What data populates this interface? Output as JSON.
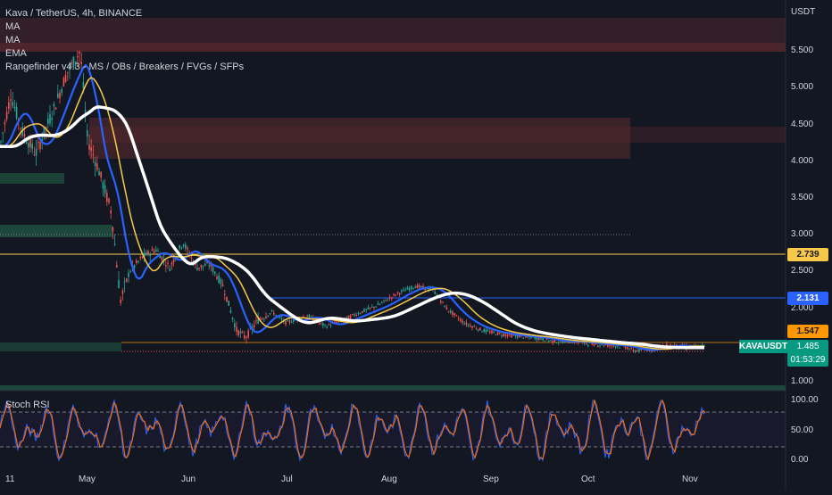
{
  "header": {
    "title": "Kava / TetherUS, 4h, BINANCE",
    "quote_currency": "USDT"
  },
  "indicators": [
    "MA",
    "MA",
    "EMA",
    "Rangefinder v4.3 - MS / OBs / Breakers / FVGs / SFPs"
  ],
  "price_axis": [
    "5.500",
    "5.000",
    "4.500",
    "4.000",
    "3.500",
    "3.000",
    "2.500",
    "2.000",
    "1.000"
  ],
  "time_axis": [
    "11",
    "May",
    "Jun",
    "Jul",
    "Aug",
    "Sep",
    "Oct",
    "Nov"
  ],
  "price_tags": {
    "level_a": "2.739",
    "level_b": "2.131",
    "level_c": "1.547",
    "current_symbol": "KAVAUSDT",
    "current_price": "1.485",
    "countdown": "01:53:29"
  },
  "stoch": {
    "label": "Stoch RSI",
    "axis": [
      "100.00",
      "50.00",
      "0.00"
    ]
  },
  "colors": {
    "background": "#131722",
    "candle_up": "#26a69a",
    "candle_down": "#ef5350",
    "ma_yellow": "#f7c948",
    "ma_blue": "#2962ff",
    "ema_white": "#ffffff",
    "supply_zone": "#5c2a2e",
    "demand_zone": "#1f4d3e",
    "stoch_k": "#2962ff",
    "stoch_d": "#ff6d00"
  }
}
